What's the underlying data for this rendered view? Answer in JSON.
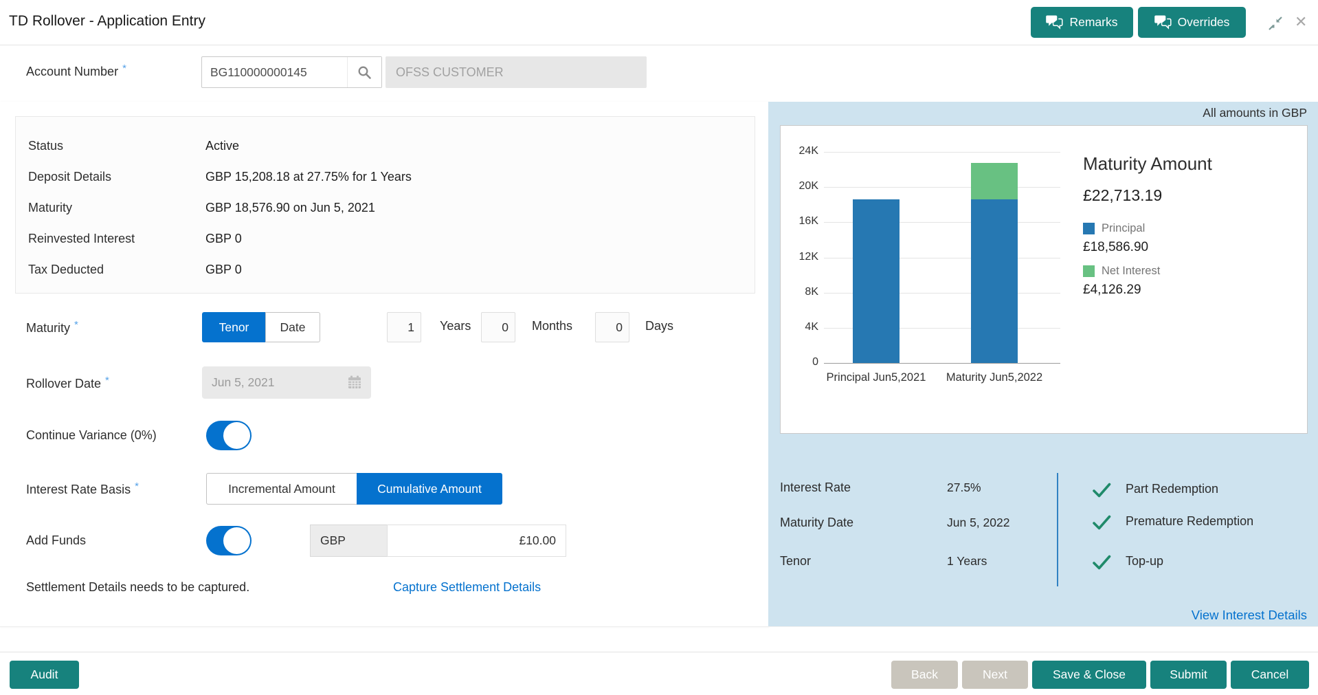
{
  "required_marker": "*",
  "header": {
    "title": "TD Rollover - Application Entry",
    "remarks_label": "Remarks",
    "overrides_label": "Overrides"
  },
  "account": {
    "label": "Account Number",
    "number": "BG110000000145",
    "customer_name": "OFSS CUSTOMER"
  },
  "summary": {
    "rows": [
      {
        "label": "Status",
        "value": "Active"
      },
      {
        "label": "Deposit Details",
        "value": "GBP 15,208.18 at 27.75% for 1 Years"
      },
      {
        "label": "Maturity",
        "value": "GBP 18,576.90 on Jun 5, 2021"
      },
      {
        "label": "Reinvested Interest",
        "value": "GBP 0"
      },
      {
        "label": "Tax Deducted",
        "value": "GBP 0"
      }
    ]
  },
  "form": {
    "maturity": {
      "label": "Maturity",
      "tenor_option": "Tenor",
      "date_option": "Date",
      "selected": "Tenor",
      "years_value": "1",
      "years_label": "Years",
      "months_value": "0",
      "months_label": "Months",
      "days_value": "0",
      "days_label": "Days"
    },
    "rollover_date": {
      "label": "Rollover Date",
      "value": "Jun 5, 2021"
    },
    "continue_variance": {
      "label": "Continue Variance (0%)",
      "enabled": true
    },
    "interest_rate_basis": {
      "label": "Interest Rate Basis",
      "incremental_option": "Incremental Amount",
      "cumulative_option": "Cumulative Amount",
      "selected": "Cumulative Amount"
    },
    "add_funds": {
      "label": "Add Funds",
      "enabled": true,
      "currency": "GBP",
      "amount": "£10.00"
    },
    "settlement": {
      "message": "Settlement Details needs to be captured.",
      "link_label": "Capture Settlement Details"
    }
  },
  "panel": {
    "note": "All amounts in GBP",
    "chart_data": {
      "type": "bar",
      "stacked": true,
      "categories": [
        "Principal Jun5,2021",
        "Maturity Jun5,2022"
      ],
      "series": [
        {
          "name": "Principal",
          "color": "#2678b2",
          "values": [
            18586.9,
            18586.9
          ]
        },
        {
          "name": "Net Interest",
          "color": "#68c182",
          "values": [
            0,
            4126.29
          ]
        }
      ],
      "ylim": [
        0,
        24000
      ],
      "yticks": [
        "24K",
        "20K",
        "16K",
        "12K",
        "8K",
        "4K",
        "0"
      ],
      "grid": true,
      "legend_position": "right"
    },
    "maturity_amount_label": "Maturity Amount",
    "maturity_amount_value": "£22,713.19",
    "legend": [
      {
        "label": "Principal",
        "value": "£18,586.90",
        "color": "#2678b2"
      },
      {
        "label": "Net Interest",
        "value": "£4,126.29",
        "color": "#68c182"
      }
    ],
    "details": [
      {
        "label": "Interest Rate",
        "value": "27.5%"
      },
      {
        "label": "Maturity Date",
        "value": "Jun 5, 2022"
      },
      {
        "label": "Tenor",
        "value": "1 Years"
      }
    ],
    "features": [
      {
        "label": "Part Redemption"
      },
      {
        "label": "Premature Redemption"
      },
      {
        "label": "Top-up"
      }
    ],
    "link_label": "View Interest Details"
  },
  "footer": {
    "audit_label": "Audit",
    "back_label": "Back",
    "next_label": "Next",
    "save_close_label": "Save & Close",
    "submit_label": "Submit",
    "cancel_label": "Cancel"
  },
  "colors": {
    "accent_teal": "#17827d",
    "primary_blue": "#0572ce",
    "panel_blue": "#cee3ef",
    "check_green": "#1f8a6a",
    "link_blue": "#0572ce"
  }
}
